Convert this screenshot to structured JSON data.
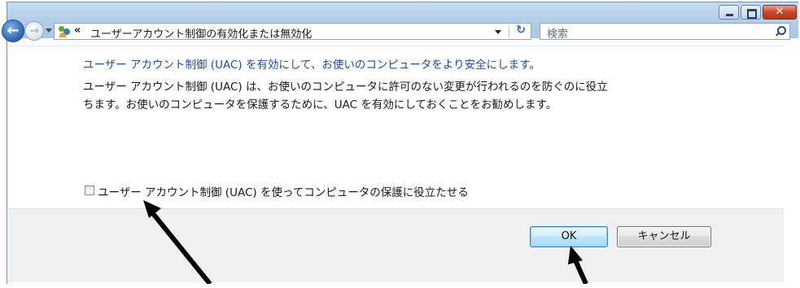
{
  "window": {
    "caption_buttons": {
      "minimize_icon": "minimize-icon",
      "maximize_icon": "maximize-icon",
      "close_icon": "close-icon",
      "close_glyph": "✕"
    }
  },
  "nav": {
    "back_glyph": "←",
    "forward_glyph": "→"
  },
  "address": {
    "chevron": "«",
    "path": "ユーザーアカウント制御の有効化または無効化",
    "refresh_glyph": "↻"
  },
  "search": {
    "placeholder": "検索"
  },
  "main": {
    "heading": "ユーザー アカウント制御 (UAC) を有効にして、お使いのコンピュータをより安全にします。",
    "paragraph_lines": [
      "ユーザー アカウント制御 (UAC) は、お使いのコンピュータに許可のない変更が行われるのを防ぐのに役立",
      "ちます。お使いのコンピュータを保護するために、UAC を有効にしておくことをお勧めします。"
    ],
    "checkbox_label": "ユーザー アカウント制御 (UAC) を使ってコンピュータの保護に役立たせる",
    "checkbox_checked": false
  },
  "buttons": {
    "ok": "OK",
    "cancel": "キャンセル"
  },
  "colors": {
    "heading": "#1e50a2",
    "titlebar": "#b5cfe9",
    "footer": "#f0f0f0",
    "close_button": "#c8462b",
    "annotation_arrow": "#000000"
  }
}
